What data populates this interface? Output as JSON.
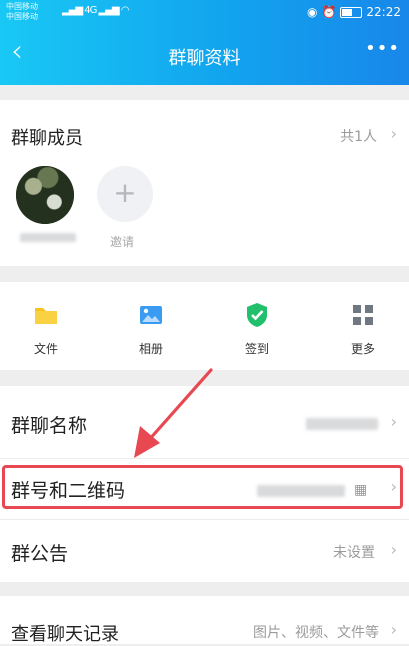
{
  "status_bar": {
    "carrier_1": "中国移动",
    "carrier_2": "中国移动",
    "network": "4G",
    "time": "22:22",
    "battery_level": 0.55
  },
  "header": {
    "title": "群聊资料",
    "back_icon": "back-chevron-icon",
    "more_icon": "more-dots-icon"
  },
  "members": {
    "label": "群聊成员",
    "count": "共1人",
    "invite_label": "邀请"
  },
  "toolbar": [
    {
      "label": "文件",
      "icon": "folder-icon",
      "color": "#f7c325"
    },
    {
      "label": "相册",
      "icon": "album-icon",
      "color": "#3a9bf2"
    },
    {
      "label": "签到",
      "icon": "checkin-icon",
      "color": "#22c06d"
    },
    {
      "label": "更多",
      "icon": "grid-icon",
      "color": "#6f7780"
    }
  ],
  "settings": {
    "group_name_label": "群聊名称",
    "group_qr_label": "群号和二维码",
    "announcement_label": "群公告",
    "announcement_value": "未设置",
    "history_label": "查看聊天记录",
    "history_value": "图片、视频、文件等"
  },
  "colors": {
    "header_start": "#19c8f5",
    "header_end": "#1887ea",
    "annotation_red": "#e84852"
  }
}
